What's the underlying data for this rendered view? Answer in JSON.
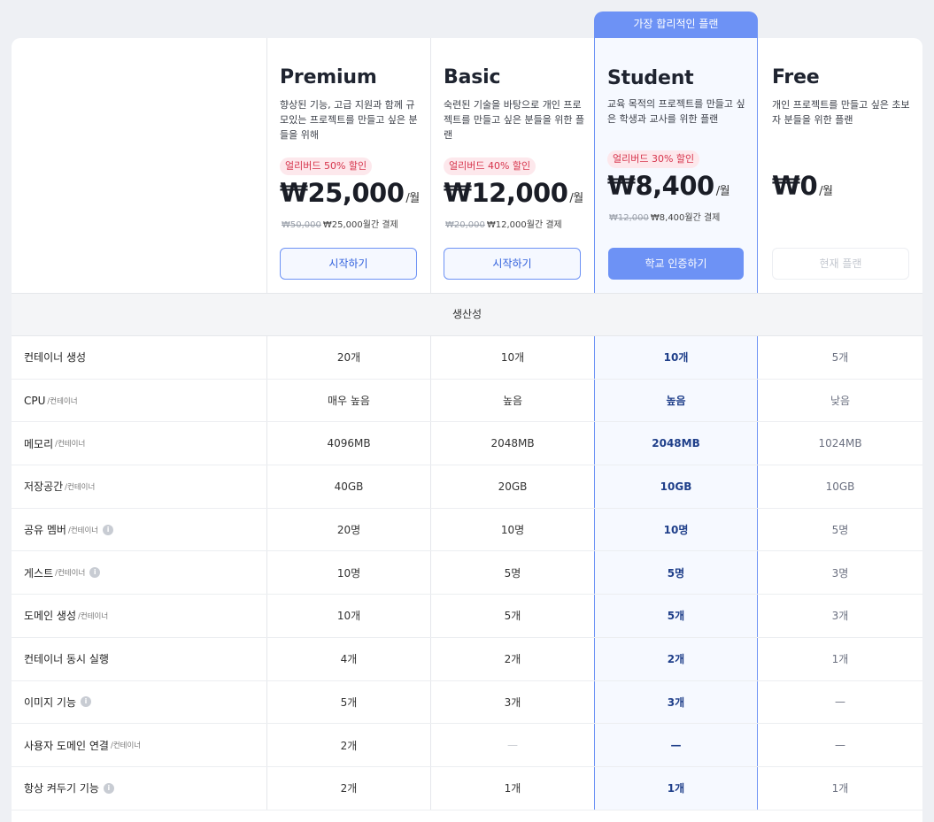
{
  "ribbon": "가장 합리적인 플랜",
  "plans": [
    {
      "name": "Premium",
      "desc": "향상된 기능, 고급 지원과 함께 규모있는 프로젝트를 만들고 싶은 분들을 위해",
      "badge": "얼리버드 50% 할인",
      "price": "₩25,000",
      "unit": "/월",
      "billing_orig": "₩50,000",
      "billing": "₩25,000월간 결제",
      "button": "시작하기"
    },
    {
      "name": "Basic",
      "desc": "숙련된 기술을 바탕으로 개인 프로젝트를 만들고 싶은 분들을 위한 플랜",
      "badge": "얼리버드 40% 할인",
      "price": "₩12,000",
      "unit": "/월",
      "billing_orig": "₩20,000",
      "billing": "₩12,000월간 결제",
      "button": "시작하기"
    },
    {
      "name": "Student",
      "desc": "교육 목적의 프로젝트를 만들고 싶은 학생과 교사를 위한 플랜",
      "badge": "얼리버드 30% 할인",
      "price": "₩8,400",
      "unit": "/월",
      "billing_orig": "₩12,000",
      "billing": "₩8,400월간 결제",
      "button": "학교 인증하기"
    },
    {
      "name": "Free",
      "desc": "개인 프로젝트를 만들고 싶은 초보자 분들을 위한 플랜",
      "price": "₩0",
      "unit": "/월",
      "button": "현재 플랜"
    }
  ],
  "section_title": "생산성",
  "dash": "—",
  "features": [
    {
      "label": "컨테이너 생성",
      "sub": "",
      "info": false,
      "values": [
        "20개",
        "10개",
        "10개",
        "5개"
      ]
    },
    {
      "label": "CPU",
      "sub": "/컨테이너",
      "info": false,
      "values": [
        "매우 높음",
        "높음",
        "높음",
        "낮음"
      ]
    },
    {
      "label": "메모리",
      "sub": "/컨테이너",
      "info": false,
      "values": [
        "4096MB",
        "2048MB",
        "2048MB",
        "1024MB"
      ]
    },
    {
      "label": "저장공간",
      "sub": "/컨테이너",
      "info": false,
      "values": [
        "40GB",
        "20GB",
        "10GB",
        "10GB"
      ]
    },
    {
      "label": "공유 멤버",
      "sub": "/컨테이너",
      "info": true,
      "values": [
        "20명",
        "10명",
        "10명",
        "5명"
      ]
    },
    {
      "label": "게스트",
      "sub": "/컨테이너",
      "info": true,
      "values": [
        "10명",
        "5명",
        "5명",
        "3명"
      ]
    },
    {
      "label": "도메인 생성",
      "sub": "/컨테이너",
      "info": false,
      "values": [
        "10개",
        "5개",
        "5개",
        "3개"
      ]
    },
    {
      "label": "컨테이너 동시 실행",
      "sub": "",
      "info": false,
      "values": [
        "4개",
        "2개",
        "2개",
        "1개"
      ]
    },
    {
      "label": "이미지 기능",
      "sub": "",
      "info": true,
      "values": [
        "5개",
        "3개",
        "3개",
        null
      ]
    },
    {
      "label": "사용자 도메인 연결",
      "sub": "/컨테이너",
      "info": false,
      "values": [
        "2개",
        null,
        null,
        null
      ]
    },
    {
      "label": "항상 켜두기 기능",
      "sub": "",
      "info": true,
      "values": [
        "2개",
        "1개",
        "1개",
        "1개"
      ]
    }
  ],
  "info_icon": "info-icon"
}
